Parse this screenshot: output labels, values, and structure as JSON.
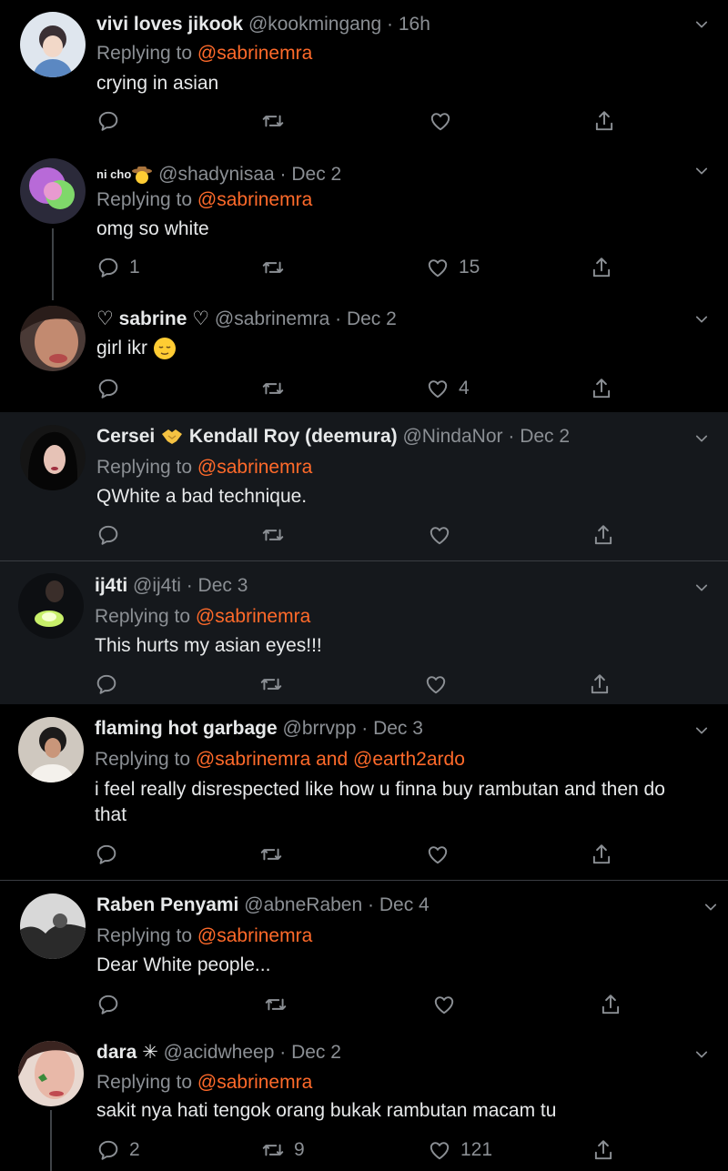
{
  "replying_label": "Replying to",
  "and_label": "and",
  "tweets": [
    {
      "name": "vivi loves jikook",
      "handle": "@kookmingang",
      "time": "16h",
      "replying": "@sabrinemra",
      "text": "crying in asian",
      "replies": "",
      "retweets": "",
      "likes": ""
    },
    {
      "name_deco": "ni cho",
      "name": "",
      "handle": "@shadynisaa",
      "time": "Dec 2",
      "replying": "@sabrinemra",
      "text": "omg so white",
      "replies": "1",
      "retweets": "",
      "likes": "15"
    },
    {
      "name": "sabrine",
      "handle": "@sabrinemra",
      "time": "Dec 2",
      "replying": "",
      "text": "girl ikr",
      "replies": "",
      "retweets": "",
      "likes": "4"
    },
    {
      "name": "Cersei",
      "name2": "Kendall Roy (deemura)",
      "handle": "@NindaNor",
      "time": "Dec 2",
      "replying": "@sabrinemra",
      "text": "QWhite a bad technique.",
      "replies": "",
      "retweets": "",
      "likes": ""
    },
    {
      "name": "ij4ti",
      "handle": "@ij4ti",
      "time": "Dec 3",
      "replying": "@sabrinemra",
      "text": "This hurts my asian eyes!!!",
      "replies": "",
      "retweets": "",
      "likes": ""
    },
    {
      "name": "flaming hot garbage",
      "handle": "@brrvpp",
      "time": "Dec 3",
      "replying": "@sabrinemra",
      "replying2": "@earth2ardo",
      "text": "i feel really disrespected like how u finna buy rambutan and then do that",
      "replies": "",
      "retweets": "",
      "likes": ""
    },
    {
      "name": "Raben Penyami",
      "handle": "@abneRaben",
      "time": "Dec 4",
      "replying": "@sabrinemra",
      "text": "Dear White people...",
      "replies": "",
      "retweets": "",
      "likes": ""
    },
    {
      "name": "dara",
      "handle": "@acidwheep",
      "time": "Dec 2",
      "replying": "@sabrinemra",
      "text": "sakit nya hati tengok orang bukak rambutan macam tu",
      "replies": "2",
      "retweets": "9",
      "likes": "121"
    }
  ],
  "colors": {
    "mention": "#ff6a2a",
    "muted": "#8b8f94",
    "dim_bg": "#15181c"
  }
}
